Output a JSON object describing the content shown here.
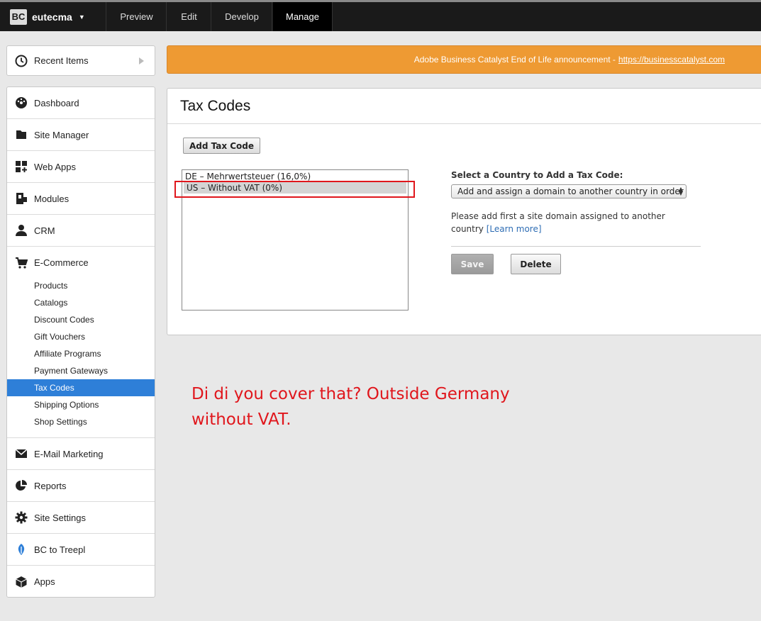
{
  "topbar": {
    "site_name": "eutecma",
    "logo_text": "BC",
    "tabs": [
      {
        "label": "Preview"
      },
      {
        "label": "Edit"
      },
      {
        "label": "Develop"
      },
      {
        "label": "Manage"
      }
    ],
    "active_tab": "Manage"
  },
  "sidebar": {
    "recent": "Recent Items",
    "items": [
      {
        "label": "Dashboard",
        "icon": "dashboard-icon"
      },
      {
        "label": "Site Manager",
        "icon": "folder-icon"
      },
      {
        "label": "Web Apps",
        "icon": "web-apps-icon"
      },
      {
        "label": "Modules",
        "icon": "modules-icon"
      },
      {
        "label": "CRM",
        "icon": "person-icon"
      },
      {
        "label": "E-Commerce",
        "icon": "cart-icon"
      },
      {
        "label": "E-Mail Marketing",
        "icon": "envelope-icon"
      },
      {
        "label": "Reports",
        "icon": "pie-chart-icon"
      },
      {
        "label": "Site Settings",
        "icon": "gear-icon"
      },
      {
        "label": "BC to Treepl",
        "icon": "treepl-icon"
      },
      {
        "label": "Apps",
        "icon": "cube-icon"
      }
    ],
    "ecommerce_sub": [
      {
        "label": "Products"
      },
      {
        "label": "Catalogs"
      },
      {
        "label": "Discount Codes"
      },
      {
        "label": "Gift Vouchers"
      },
      {
        "label": "Affiliate Programs"
      },
      {
        "label": "Payment Gateways"
      },
      {
        "label": "Tax Codes"
      },
      {
        "label": "Shipping Options"
      },
      {
        "label": "Shop Settings"
      }
    ],
    "active_sub": "Tax Codes"
  },
  "banner": {
    "text": "Adobe Business Catalyst End of Life announcement -",
    "link": "https://businesscatalyst.com"
  },
  "main": {
    "title": "Tax Codes",
    "add_button": "Add Tax Code",
    "tax_codes": [
      {
        "label": "DE – Mehrwertsteuer (16,0%)"
      },
      {
        "label": "US – Without VAT (0%)"
      }
    ],
    "selected_tax_code": "US – Without VAT (0%)",
    "country_label": "Select a Country to Add a Tax Code:",
    "country_select_value": "Add and assign a domain to another country in order",
    "help_text": "Please add first a site domain assigned to another country",
    "help_link": "[Learn more]",
    "save_button": "Save",
    "delete_button": "Delete"
  },
  "annotation": {
    "line1": "Di di you cover that? Outside Germany",
    "line2": "without VAT."
  },
  "colors": {
    "topbar": "#1a1a1a",
    "banner": "#ee9a33",
    "active_item": "#2e7fd8",
    "annotation": "#e0161c"
  }
}
